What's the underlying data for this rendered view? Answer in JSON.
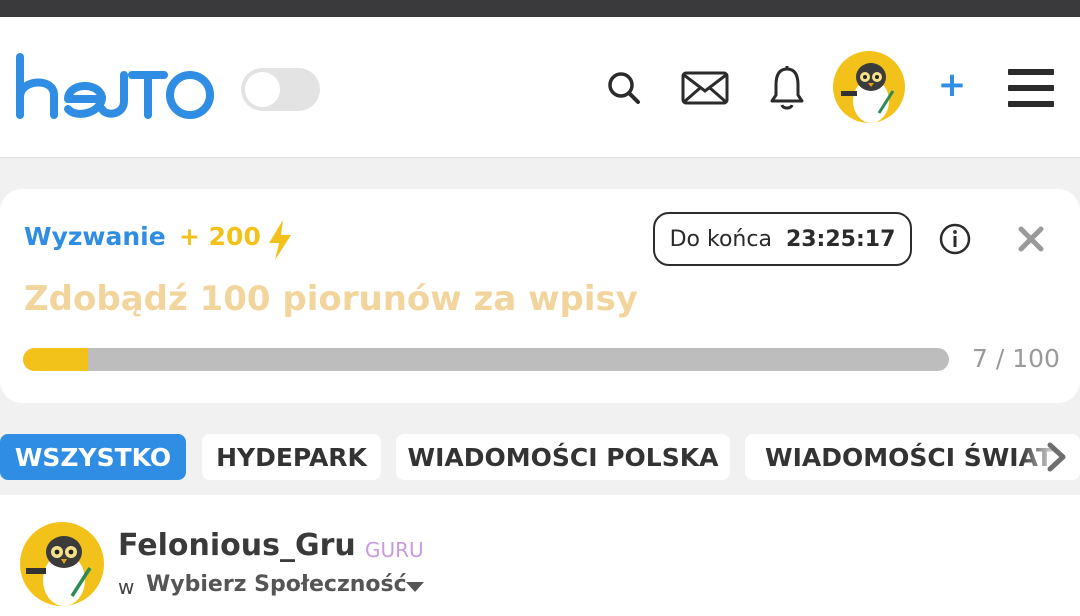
{
  "header": {
    "logo_text": "hejto",
    "brand_color": "#2f8de4",
    "icons": [
      "search-icon",
      "mail-icon",
      "bell-icon",
      "plus-icon",
      "menu-icon"
    ],
    "plus_label": "+"
  },
  "challenge": {
    "label": "Wyzwanie",
    "points": "+ 200",
    "timer_prefix": "Do końca",
    "timer_value": "23:25:17",
    "title": "Zdobądź 100 piorunów za wpisy",
    "progress_text": "7 / 100",
    "progress_fraction": 0.07,
    "accent_color": "#f2c21a"
  },
  "tabs": [
    {
      "label": "WSZYSTKO",
      "active": true
    },
    {
      "label": "HYDEPARK",
      "active": false
    },
    {
      "label": "WIADOMOŚCI POLSKA",
      "active": false
    },
    {
      "label": "WIADOMOŚCI ŚWIAT",
      "active": false
    }
  ],
  "post": {
    "author": "Felonious_Gru",
    "rank": "GURU",
    "in_word": "w",
    "community": "Wybierz Społeczność"
  }
}
